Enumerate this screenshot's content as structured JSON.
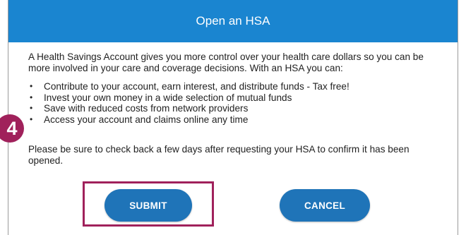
{
  "dialog": {
    "title": "Open an HSA",
    "intro": "A Health Savings Account gives you more control over your health care dollars so you can be more involved in your care and coverage decisions. With an HSA you can:",
    "bullets": [
      "Contribute to your account, earn interest, and distribute funds - Tax free!",
      "Invest your own money in a wide selection of mutual funds",
      "Save with reduced costs from network providers",
      "Access your account and claims online any time"
    ],
    "note": "Please be sure to check back a few days after requesting your HSA to confirm it has been opened.",
    "submit_label": "SUBMIT",
    "cancel_label": "CANCEL"
  },
  "annotation": {
    "step_number": "4"
  },
  "colors": {
    "header_bg": "#1a85d0",
    "button_bg": "#1f74b8",
    "highlight": "#a0215b"
  }
}
